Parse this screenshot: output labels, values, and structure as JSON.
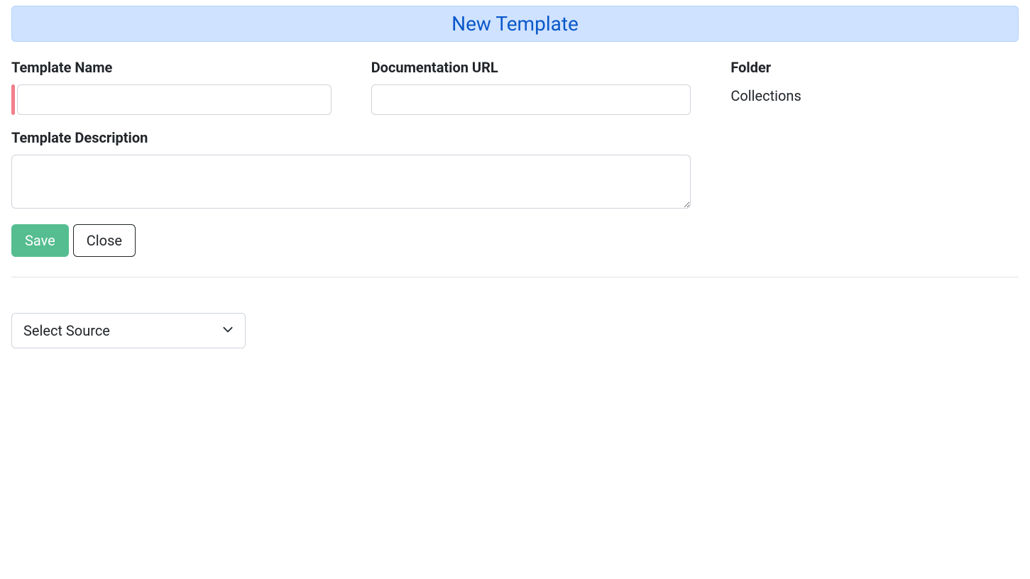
{
  "header": {
    "title": "New Template"
  },
  "form": {
    "template_name": {
      "label": "Template Name",
      "value": ""
    },
    "documentation_url": {
      "label": "Documentation URL",
      "value": ""
    },
    "folder": {
      "label": "Folder",
      "value": "Collections"
    },
    "template_description": {
      "label": "Template Description",
      "value": ""
    }
  },
  "actions": {
    "save_label": "Save",
    "close_label": "Close"
  },
  "source_select": {
    "label": "Select Source"
  }
}
